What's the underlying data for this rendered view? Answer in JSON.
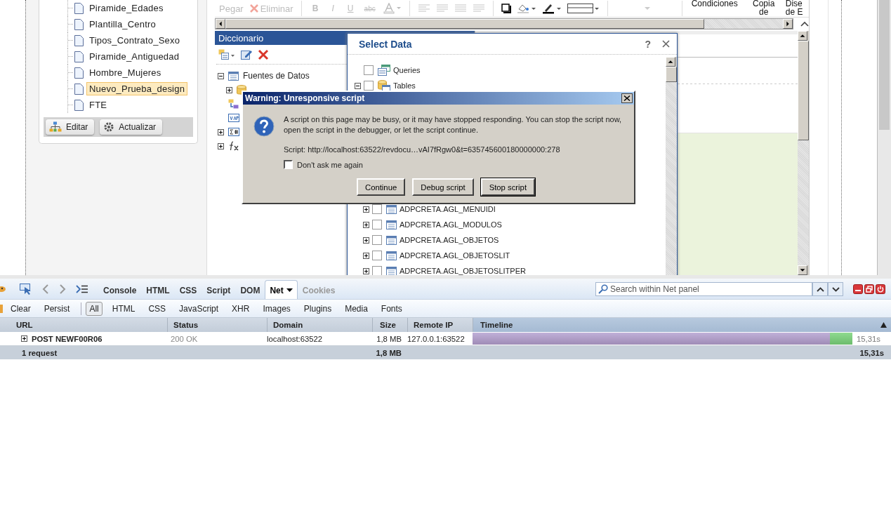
{
  "left_panel": {
    "reports": [
      {
        "label": "Piramide_Edades",
        "selected": false
      },
      {
        "label": "Plantilla_Centro",
        "selected": false
      },
      {
        "label": "Tipos_Contrato_Sexo",
        "selected": false
      },
      {
        "label": "Piramide_Antiguedad",
        "selected": false
      },
      {
        "label": "Hombre_Mujeres",
        "selected": false
      },
      {
        "label": "Nuevo_Prueba_design",
        "selected": true
      },
      {
        "label": "FTE",
        "selected": false
      }
    ],
    "buttons": [
      {
        "label": "Editar",
        "kind": "edit"
      },
      {
        "label": "Actualizar",
        "kind": "refresh"
      }
    ]
  },
  "ribbon": {
    "clipboard": [
      {
        "label": "Pegar",
        "kind": "paste",
        "disabled": true
      },
      {
        "label": "Eliminar",
        "kind": "delete",
        "disabled": true
      }
    ],
    "font_buttons": [
      {
        "label": "B",
        "kind": "bold",
        "disabled": true
      },
      {
        "label": "I",
        "kind": "italic",
        "disabled": true
      },
      {
        "label": "U",
        "kind": "underline",
        "disabled": true
      },
      {
        "label": "abc",
        "kind": "strike",
        "disabled": true
      }
    ],
    "commands": [
      {
        "label": "Condiciones"
      },
      {
        "label": "Copia de"
      },
      {
        "label": "Dise de E"
      }
    ]
  },
  "dictionary": {
    "title": "Diccionario",
    "tree": [
      {
        "label": "Fuentes de Datos",
        "kind": "source",
        "expanded": true,
        "children": [
          {
            "kind": "database",
            "expanded": false
          }
        ]
      },
      {
        "kind": "relations"
      },
      {
        "kind": "variables"
      },
      {
        "kind": "totals",
        "expanded": false
      },
      {
        "kind": "functions",
        "expanded": false
      }
    ]
  },
  "select_data": {
    "title": "Select Data",
    "help": "?",
    "items": [
      {
        "label": "Queries",
        "kind": "query",
        "checked": false
      },
      {
        "label": "Tables",
        "kind": "folder",
        "checked": false,
        "expanded": true
      }
    ],
    "tables": [
      {
        "label": "ADPCRETA.AGL_MENUIDI",
        "checked": false,
        "expanded": false
      },
      {
        "label": "ADPCRETA.AGL_MODULOS",
        "checked": false,
        "expanded": false
      },
      {
        "label": "ADPCRETA.AGL_OBJETOS",
        "checked": false,
        "expanded": false
      },
      {
        "label": "ADPCRETA.AGL_OBJETOSLIT",
        "checked": false,
        "expanded": false
      },
      {
        "label": "ADPCRETA.AGL_OBJETOSLITPER",
        "checked": false,
        "expanded": false
      }
    ]
  },
  "warning": {
    "title": "Warning: Unresponsive script",
    "message": "A script on this page may be busy, or it may have stopped responding. You can stop the script now, open the script in the debugger, or let the script continue.",
    "script": "Script: http://localhost:63522/revdocu…vAI7fRgw0&t=635745600180000000:278",
    "dont_ask": {
      "label": "Don't ask me again",
      "checked": false
    },
    "buttons": [
      {
        "label": "Continue",
        "focused": false
      },
      {
        "label": "Debug script",
        "focused": false
      },
      {
        "label": "Stop script",
        "focused": true
      }
    ]
  },
  "firebug": {
    "tabs": [
      {
        "label": "Console",
        "selected": false,
        "disabled": false
      },
      {
        "label": "HTML",
        "selected": false,
        "disabled": false
      },
      {
        "label": "CSS",
        "selected": false,
        "disabled": false
      },
      {
        "label": "Script",
        "selected": false,
        "disabled": false
      },
      {
        "label": "DOM",
        "selected": false,
        "disabled": false
      },
      {
        "label": "Net",
        "selected": true,
        "disabled": false
      },
      {
        "label": "Cookies",
        "selected": false,
        "disabled": true
      }
    ],
    "search": {
      "placeholder": "Search within Net panel"
    },
    "actions": [
      "Clear",
      "Persist"
    ],
    "filters": [
      {
        "label": "All",
        "selected": true
      },
      {
        "label": "HTML",
        "selected": false
      },
      {
        "label": "CSS",
        "selected": false
      },
      {
        "label": "JavaScript",
        "selected": false
      },
      {
        "label": "XHR",
        "selected": false
      },
      {
        "label": "Images",
        "selected": false
      },
      {
        "label": "Plugins",
        "selected": false
      },
      {
        "label": "Media",
        "selected": false
      },
      {
        "label": "Fonts",
        "selected": false
      }
    ],
    "columns": [
      "URL",
      "Status",
      "Domain",
      "Size",
      "Remote IP",
      "Timeline"
    ],
    "rows": [
      {
        "url": "POST NEWF00R06",
        "status": "200 OK",
        "domain": "localhost:63522",
        "size": "1,8 MB",
        "remote_ip": "127.0.0.1:63522",
        "level": 0.94,
        "time": "15,31s",
        "expanded": false
      }
    ],
    "summary": {
      "count": "1 request",
      "size": "1,8 MB",
      "time": "15,31s"
    }
  }
}
